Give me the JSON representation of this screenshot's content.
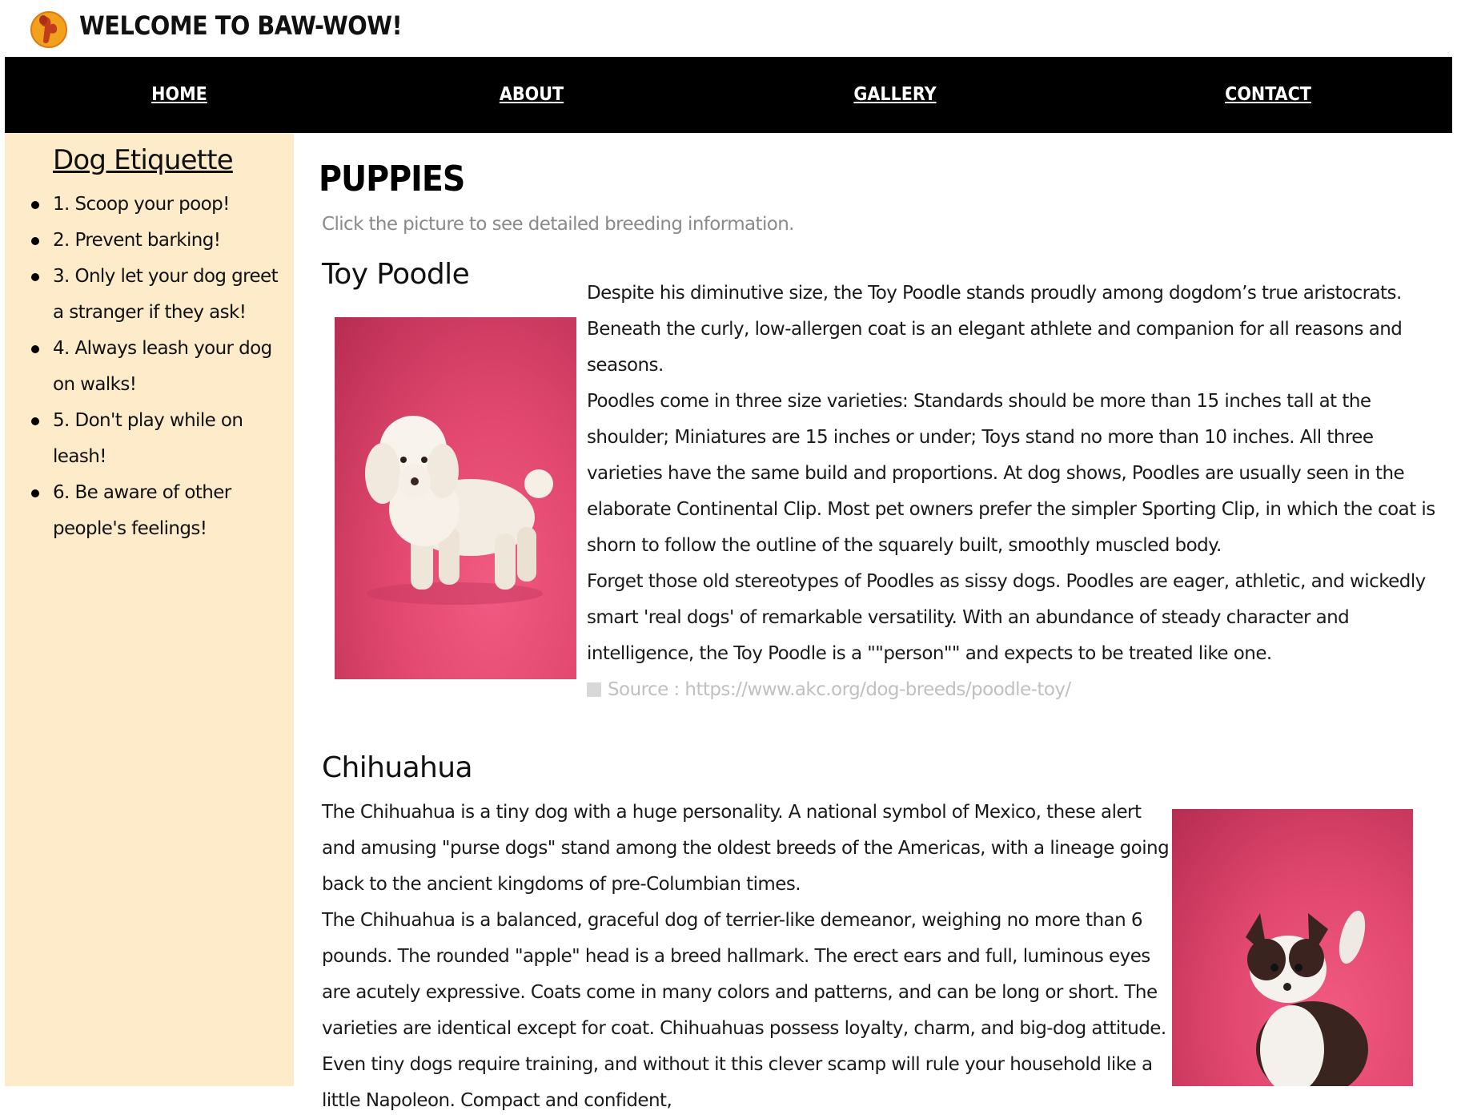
{
  "header": {
    "title": "WELCOME TO BAW-WOW!",
    "logo_icon": "dog-logo-icon"
  },
  "nav": {
    "items": [
      {
        "label": "HOME"
      },
      {
        "label": "ABOUT"
      },
      {
        "label": "GALLERY"
      },
      {
        "label": "CONTACT"
      }
    ]
  },
  "sidebar": {
    "title": "Dog Etiquette",
    "items": [
      "1. Scoop your poop!",
      "2. Prevent barking!",
      "3. Only let your dog greet a stranger if they ask!",
      "4. Always leash your dog on walks!",
      "5. Don't play while on leash!",
      "6. Be aware of other people's feelings!"
    ]
  },
  "main": {
    "title": "PUPPIES",
    "instructions": "Click the picture to see detailed breeding information.",
    "breeds": [
      {
        "name": "Toy Poodle",
        "paragraphs": [
          "Despite his diminutive size, the Toy Poodle stands proudly among dogdom’s true aristocrats. Beneath the curly, low-allergen coat is an elegant athlete and companion for all reasons and seasons.",
          "Poodles come in three size varieties: Standards should be more than 15 inches tall at the shoulder; Miniatures are 15 inches or under; Toys stand no more than 10 inches. All three varieties have the same build and proportions. At dog shows, Poodles are usually seen in the elaborate Continental Clip. Most pet owners prefer the simpler Sporting Clip, in which the coat is shorn to follow the outline of the squarely built, smoothly muscled body.",
          "Forget those old stereotypes of Poodles as sissy dogs. Poodles are eager, athletic, and wickedly smart 'real dogs'  of remarkable versatility. With an abundance of steady character and intelligence, the Toy Poodle is a \"\"person\"\" and expects to be treated like one."
        ],
        "source": "Source : https://www.akc.org/dog-breeds/poodle-toy/"
      },
      {
        "name": "Chihuahua",
        "paragraphs": [
          "The Chihuahua is a tiny dog with a huge personality. A national symbol of Mexico, these alert and amusing \"purse dogs\" stand among the oldest breeds of the Americas, with a lineage going back to the ancient kingdoms of pre-Columbian times.",
          "The Chihuahua is a balanced, graceful dog of terrier-like demeanor, weighing no more than 6 pounds. The rounded \"apple\" head is a breed hallmark. The erect ears and full, luminous eyes are acutely expressive. Coats come in many colors and patterns, and can be long or short. The varieties are identical except for coat. Chihuahuas possess loyalty, charm, and big-dog attitude. Even tiny dogs require training, and without it this clever scamp will rule your household like a little Napoleon. Compact and confident,"
        ]
      }
    ]
  },
  "colors": {
    "nav_bg": "#000000",
    "sidebar_bg": "#fdebca",
    "photo_bg": "#e2486f"
  }
}
